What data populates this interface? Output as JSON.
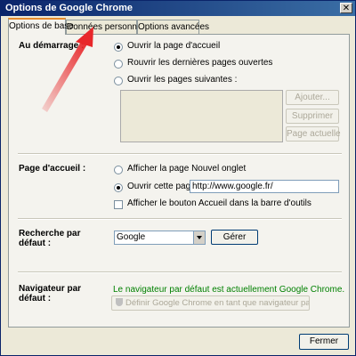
{
  "window": {
    "title": "Options de Google Chrome",
    "close_glyph": "✕"
  },
  "tabs": [
    {
      "label": "Options de base",
      "active": true
    },
    {
      "label": "Données personnelles",
      "active": false
    },
    {
      "label": "Options avancées",
      "active": false
    }
  ],
  "startup": {
    "label": "Au démarrage :",
    "options": [
      {
        "label": "Ouvrir la page d'accueil",
        "selected": true
      },
      {
        "label": "Rouvrir les dernières pages ouvertes",
        "selected": false
      },
      {
        "label": "Ouvrir les pages suivantes :",
        "selected": false
      }
    ],
    "buttons": {
      "add": "Ajouter...",
      "remove": "Supprimer",
      "current": "Page actuelle"
    }
  },
  "homepage": {
    "label": "Page d'accueil :",
    "options": [
      {
        "label": "Afficher la page Nouvel onglet",
        "selected": false
      },
      {
        "label": "Ouvrir cette page :",
        "selected": true
      }
    ],
    "url_value": "http://www.google.fr/",
    "show_home_button_label": "Afficher le bouton Accueil dans la barre d'outils",
    "show_home_button_checked": false
  },
  "search": {
    "label_line1": "Recherche par",
    "label_line2": "défaut :",
    "selected_engine": "Google",
    "manage_button": "Gérer"
  },
  "default_browser": {
    "label_line1": "Navigateur par",
    "label_line2": "défaut :",
    "status_text": "Le navigateur par défaut est actuellement Google Chrome.",
    "status_color": "#008000",
    "set_default_button": "Définir Google Chrome en tant que navigateur par défaut"
  },
  "footer": {
    "close_button": "Fermer"
  },
  "colors": {
    "title_bar": "#0a246a",
    "annotation_arrow": "#e8272a",
    "active_tab_accent": "#e68b2c"
  }
}
